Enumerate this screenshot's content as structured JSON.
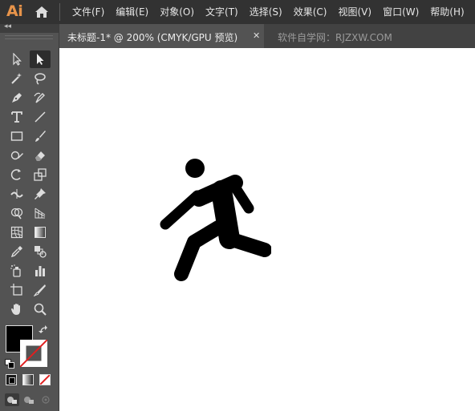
{
  "app": {
    "logo_text": "Ai",
    "home_icon": "home-icon"
  },
  "menu": [
    "文件(F)",
    "编辑(E)",
    "对象(O)",
    "文字(T)",
    "选择(S)",
    "效果(C)",
    "视图(V)",
    "窗口(W)",
    "帮助(H)"
  ],
  "tabs": {
    "active_label": "未标题-1* @ 200% (CMYK/GPU 预览)",
    "close_glyph": "✕",
    "inactive_label": "软件自学网：RJZXW.COM"
  },
  "toolbar": {
    "collapse_glyph": "◂◂",
    "tools": [
      "selection-tool-icon",
      "direct-selection-tool-icon",
      "magic-wand-tool-icon",
      "lasso-tool-icon",
      "pen-tool-icon",
      "curvature-tool-icon",
      "type-tool-icon",
      "line-segment-tool-icon",
      "rectangle-tool-icon",
      "paintbrush-tool-icon",
      "shaper-tool-icon",
      "eraser-tool-icon",
      "rotate-tool-icon",
      "scale-tool-icon",
      "width-tool-icon",
      "puppet-warp-tool-icon",
      "shape-builder-tool-icon",
      "perspective-grid-tool-icon",
      "mesh-tool-icon",
      "gradient-tool-icon",
      "eyedropper-tool-icon",
      "blend-tool-icon",
      "symbol-sprayer-tool-icon",
      "column-graph-tool-icon",
      "artboard-tool-icon",
      "slice-tool-icon",
      "hand-tool-icon",
      "zoom-tool-icon"
    ],
    "fill_color": "#000000",
    "stroke_color": "none"
  },
  "canvas": {
    "artwork": "running-man-icon",
    "artwork_color": "#000000"
  }
}
